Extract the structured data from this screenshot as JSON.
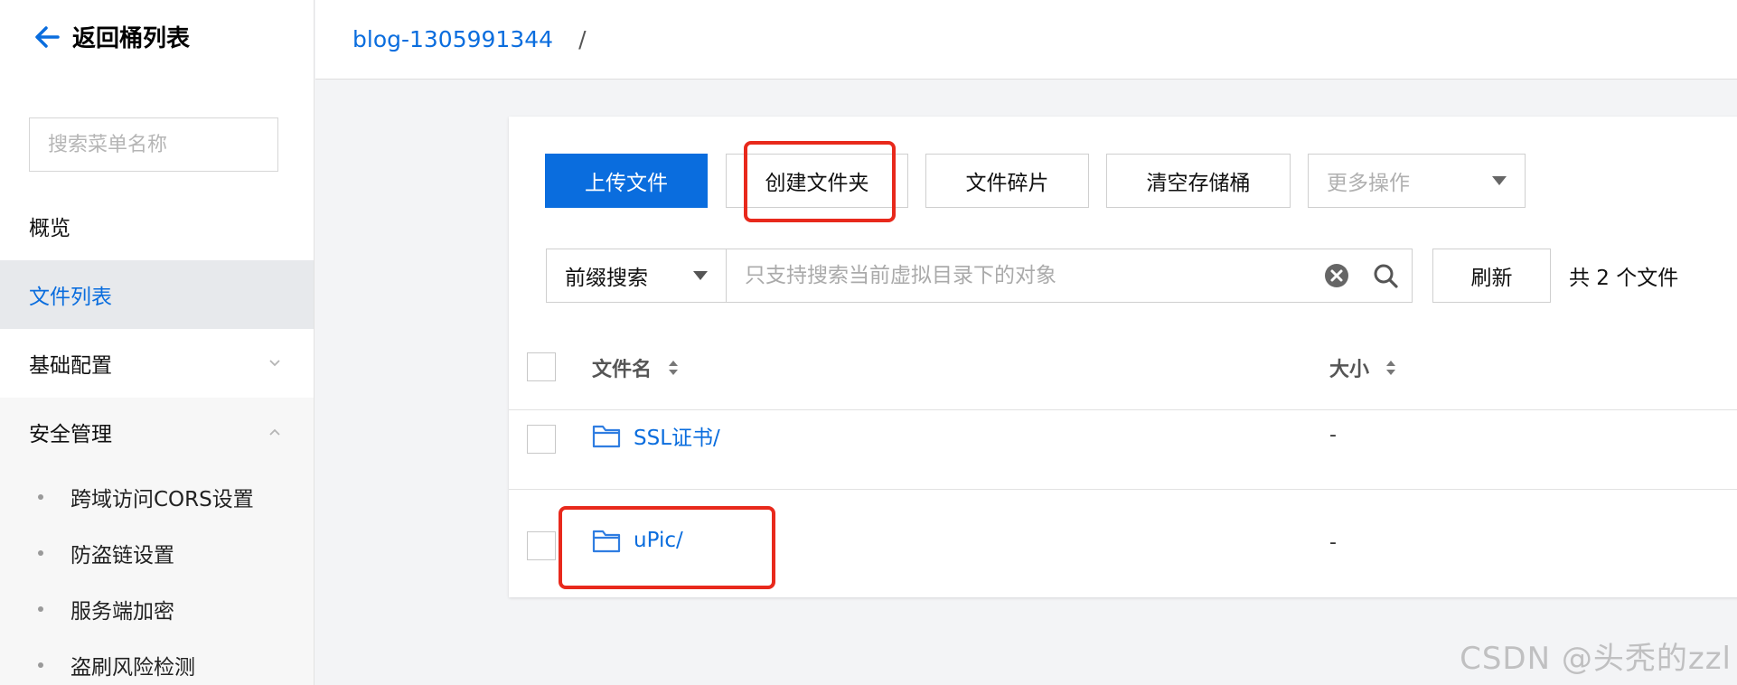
{
  "sidebar": {
    "back_label": "返回桶列表",
    "search_placeholder": "搜索菜单名称",
    "items": [
      {
        "label": "概览"
      },
      {
        "label": "文件列表"
      },
      {
        "label": "基础配置"
      },
      {
        "label": "安全管理"
      }
    ],
    "security_sub_items": [
      {
        "label": "跨域访问CORS设置"
      },
      {
        "label": "防盗链设置"
      },
      {
        "label": "服务端加密"
      },
      {
        "label": "盗刷风险检测"
      }
    ]
  },
  "breadcrumb": {
    "bucket": "blog-1305991344",
    "separator": "/"
  },
  "toolbar": {
    "upload_label": "上传文件",
    "create_folder_label": "创建文件夹",
    "fragments_label": "文件碎片",
    "empty_bucket_label": "清空存储桶",
    "more_actions_label": "更多操作"
  },
  "search": {
    "prefix_select_value": "前缀搜索",
    "placeholder": "只支持搜索当前虚拟目录下的对象",
    "refresh_label": "刷新",
    "file_count_text": "共 2 个文件"
  },
  "table": {
    "columns": {
      "name": "文件名",
      "size": "大小"
    },
    "rows": [
      {
        "name": "SSL证书/",
        "size": "-"
      },
      {
        "name": "uPic/",
        "size": "-"
      }
    ]
  },
  "watermark": "CSDN @头秃的zzl",
  "colors": {
    "accent": "#0a6dde",
    "highlight": "#e8291c"
  },
  "icons": {
    "back": "arrow-left-icon",
    "search": "search-icon",
    "clear": "clear-circle-icon",
    "folder": "folder-icon",
    "sort": "sort-icon",
    "chevron_down": "chevron-down-icon",
    "chevron_up": "chevron-up-icon"
  }
}
